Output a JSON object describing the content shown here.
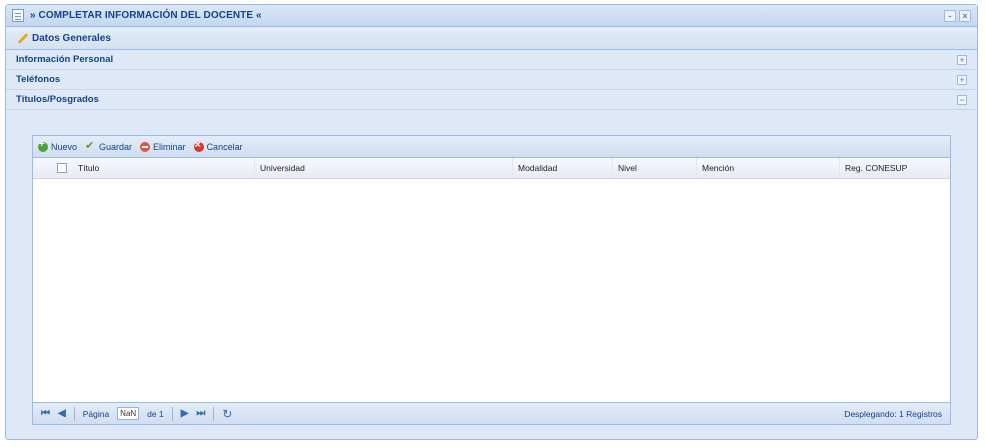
{
  "window": {
    "title": "» COMPLETAR INFORMACIÓN DEL DOCENTE «",
    "tools": {
      "minimize": "-",
      "close": "×"
    }
  },
  "section": {
    "title": "Datos Generales"
  },
  "accordion": [
    {
      "label": "Información Personal",
      "toggle": "+"
    },
    {
      "label": "Teléfonos",
      "toggle": "+"
    },
    {
      "label": "Títulos/Posgrados",
      "toggle": "−"
    }
  ],
  "toolbar": {
    "new_label": "Nuevo",
    "save_label": "Guardar",
    "delete_label": "Eliminar",
    "cancel_label": "Cancelar"
  },
  "grid": {
    "columns": [
      "Título",
      "Universidad",
      "Modalidad",
      "Nivel",
      "Mención",
      "Reg. CONESUP"
    ]
  },
  "pager": {
    "first": "⏮",
    "prev": "◀",
    "page_label": "Página",
    "page_value": "NaN",
    "of_label": "de 1",
    "next": "▶",
    "last": "⏭",
    "status": "Desplegando: 1 Registros"
  },
  "colors": {
    "header_blue": "#15428b",
    "panel_bg": "#dfe8f6",
    "border": "#99bbe8"
  }
}
